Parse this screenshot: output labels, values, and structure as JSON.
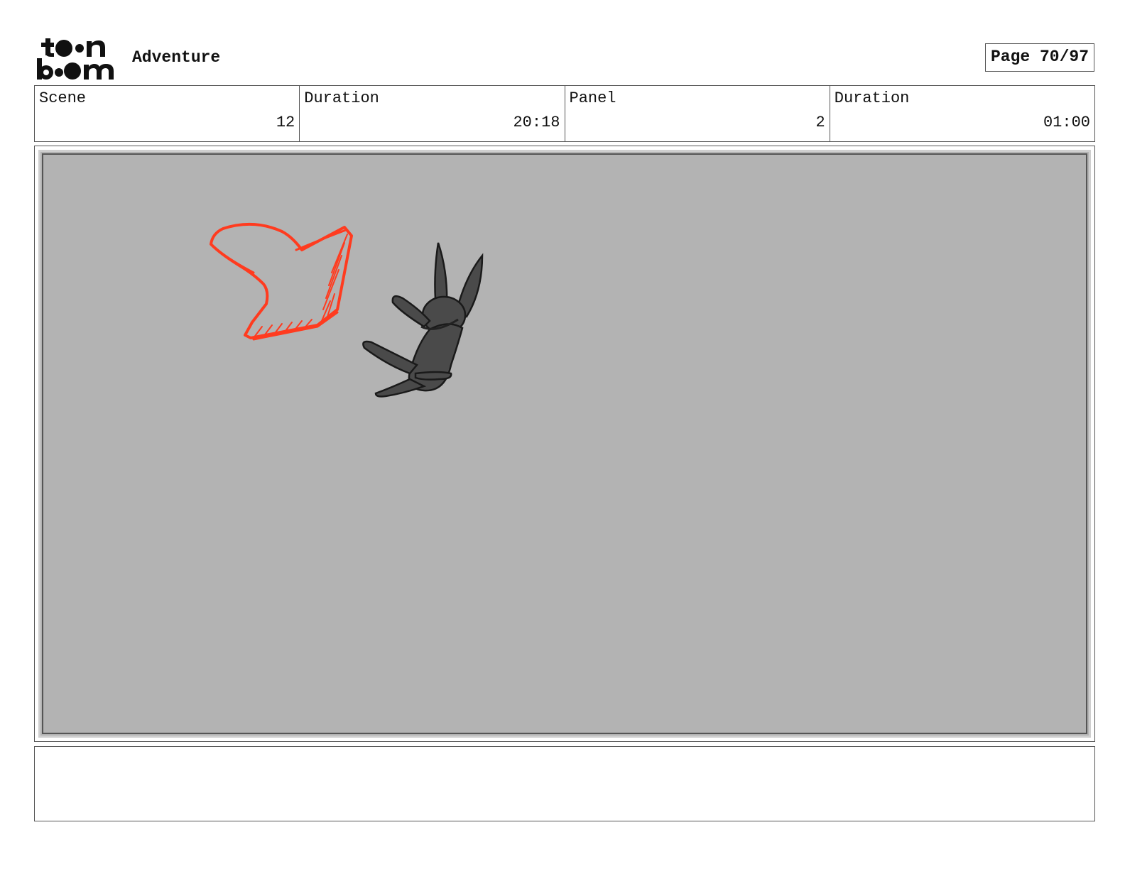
{
  "header": {
    "logo_text": "toon boom",
    "project_title": "Adventure",
    "page_label": "Page 70/97"
  },
  "info": {
    "scene_label": "Scene",
    "scene_value": "12",
    "scene_duration_label": "Duration",
    "scene_duration_value": "20:18",
    "panel_label": "Panel",
    "panel_value": "2",
    "panel_duration_label": "Duration",
    "panel_duration_value": "01:00"
  },
  "panel": {
    "background_color": "#b3b3b3",
    "arrow_color": "#ff3b1f",
    "character_color": "#4a4a4a",
    "arrow_icon": "arrow-sketch-icon",
    "character_icon": "rabbit-silhouette-icon"
  },
  "notes": {
    "text": ""
  }
}
